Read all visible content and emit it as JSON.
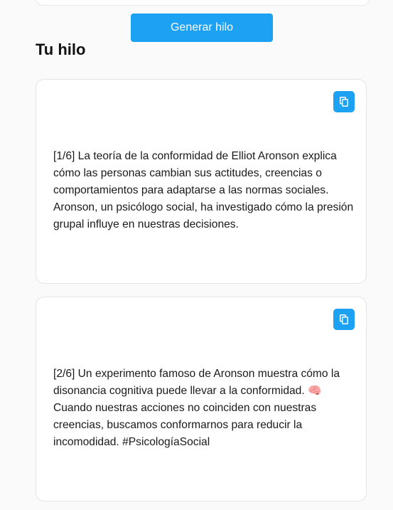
{
  "generate_button": {
    "label": "Generar hilo"
  },
  "thread": {
    "title": "Tu hilo",
    "tweets": [
      {
        "text": "[1/6] La teoría de la conformidad de Elliot Aronson explica cómo las personas cambian sus actitudes, creencias o comportamientos para adaptarse a las normas sociales. Aronson, un psicólogo social, ha investigado cómo la presión grupal influye en nuestras decisiones."
      },
      {
        "text": "[2/6] Un experimento famoso de Aronson muestra cómo la disonancia cognitiva puede llevar a la conformidad. 🧠 Cuando nuestras acciones no coinciden con nuestras creencias, buscamos conformarnos para reducir la incomodidad. #PsicologíaSocial"
      }
    ]
  },
  "icons": {
    "copy": "copy-icon"
  },
  "colors": {
    "accent": "#1da1f2",
    "background": "#fafafa",
    "card": "#ffffff",
    "card_border": "#e4e4e4"
  }
}
